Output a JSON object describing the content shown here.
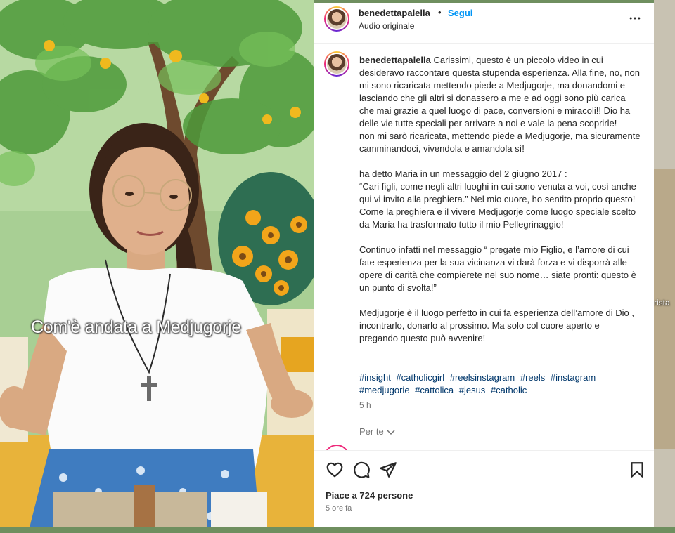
{
  "video": {
    "caption": "Com'è andata a Medjugorje"
  },
  "post": {
    "username": "benedettapalella",
    "separator": "•",
    "follow_label": "Segui",
    "audio_label": "Audio originale",
    "caption_author": "benedettapalella",
    "caption_body": " Carissimi, questo è un piccolo video in cui desideravo raccontare questa stupenda esperienza. Alla fine, no, non mi sono ricaricata mettendo piede a Medjugorje, ma donandomi e lasciando che gli altri si donassero a me e ad oggi sono più carica che mai grazie a quel luogo di pace, conversioni e miracoli!! Dio ha delle vie tutte speciali per arrivare a noi e vale la pena scoprirle!\nnon mi sarò ricaricata, mettendo piede a Medjugorje, ma sicuramente camminandoci, vivendola e amandola sì!\n\nha detto Maria in un messaggio del 2 giugno 2017 :\n“Cari figli, come negli altri luoghi in cui sono venuta a voi, così anche qui vi invito alla preghiera.” Nel mio cuore, ho sentito proprio questo! Come la preghiera e il vivere Medjugorje come luogo speciale scelto da Maria ha trasformato tutto il mio Pellegrinaggio!\n\nContinuo infatti nel messaggio “ pregate mio Figlio, e l’amore di cui fate esperienza per la sua vicinanza vi darà forza e vi disporrà alle opere di carità che compierete nel suo nome… siate pronti: questo è un punto di svolta!”\n\nMedjugorje è il luogo perfetto in cui fa esperienza dell’amore di Dio , incontrarlo, donarlo al prossimo. Ma solo col cuore aperto e pregando questo può avvenire!",
    "hashtags": [
      "#insight",
      "#catholicgirl",
      "#reelsinstagram",
      "#reels",
      "#instagram",
      "#medjugorie",
      "#cattolica",
      "#jesus",
      "#catholic"
    ],
    "caption_time": "5 h",
    "per_te": "Per te",
    "likes": "Piace a 724 persone",
    "posted_ago": "5 ore fa"
  },
  "background": {
    "peek_text": "rista"
  },
  "icons": {
    "more": "more-icon",
    "like": "heart-icon",
    "comment": "comment-icon",
    "share": "share-icon",
    "save": "bookmark-icon"
  }
}
